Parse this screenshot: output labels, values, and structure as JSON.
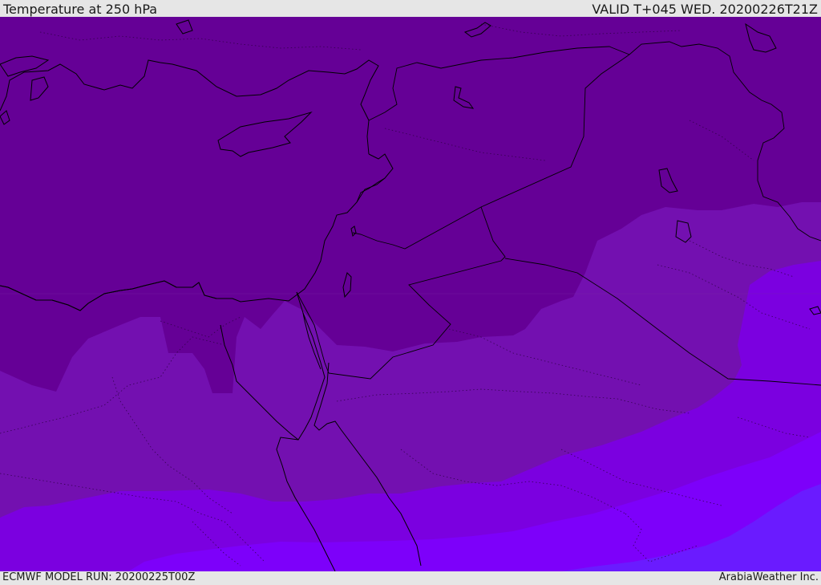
{
  "header": {
    "title": "Temperature at 250 hPa",
    "valid": "VALID T+045 WED. 20200226T21Z"
  },
  "footer": {
    "model_run": "ECMWF MODEL RUN: 20200225T00Z",
    "brand": "ArabiaWeather Inc."
  },
  "colors": {
    "band_1": "#650096",
    "band_2": "#7310b0",
    "band_3": "#7b00e0",
    "band_4": "#7d00fa",
    "band_5": "#6a1bff",
    "coastline": "#000000",
    "frame": "#e6e6e6"
  },
  "map": {
    "region": "Eastern Mediterranean and Middle East",
    "variable": "temperature",
    "level": "250 hPa"
  }
}
